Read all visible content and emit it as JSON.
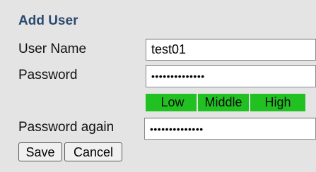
{
  "form": {
    "title": "Add User",
    "username_label": "User Name",
    "username_value": "test01",
    "password_label": "Password",
    "password_value": "••••••••••••••",
    "password_again_label": "Password again",
    "password_again_value": "••••••••••••••",
    "strength": {
      "low": "Low",
      "middle": "Middle",
      "high": "High",
      "color": "#22c122"
    },
    "save_label": "Save",
    "cancel_label": "Cancel"
  }
}
